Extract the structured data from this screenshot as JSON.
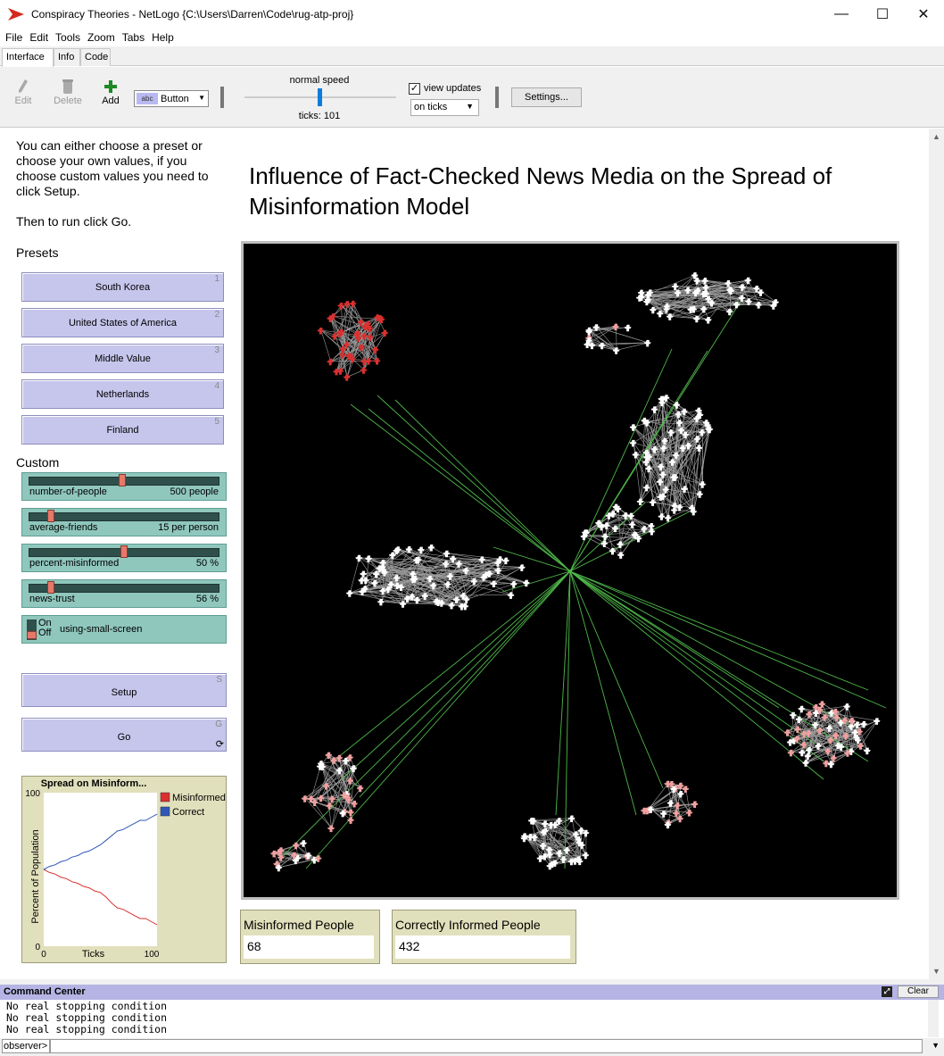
{
  "window": {
    "title": "Conspiracy Theories - NetLogo {C:\\Users\\Darren\\Code\\rug-atp-proj}",
    "controls": [
      "—",
      "☐",
      "✕"
    ]
  },
  "menu": [
    "File",
    "Edit",
    "Tools",
    "Zoom",
    "Tabs",
    "Help"
  ],
  "tabs": [
    "Interface",
    "Info",
    "Code"
  ],
  "toolbar": {
    "edit": "Edit",
    "delete": "Delete",
    "add": "Add",
    "widget_type": "Button",
    "widget_pic": "abc",
    "speed_label": "normal speed",
    "speed": 0.5,
    "ticks": "ticks: 101",
    "view_updates": "view updates",
    "update_mode": "on ticks",
    "settings": "Settings..."
  },
  "notes": {
    "intro": "You can either choose a preset or choose your own values, if you choose custom values you need to click Setup.",
    "run": "Then to run click Go.",
    "presets": "Presets",
    "custom": "Custom",
    "title": "Influence of Fact-Checked News Media on the Spread of Misinformation Model"
  },
  "presets": [
    {
      "label": "South Korea",
      "key": "1"
    },
    {
      "label": "United States of America",
      "key": "2"
    },
    {
      "label": "Middle Value",
      "key": "3"
    },
    {
      "label": "Netherlands",
      "key": "4"
    },
    {
      "label": "Finland",
      "key": "5"
    }
  ],
  "sliders": [
    {
      "name": "number-of-people",
      "value": "500 people",
      "fraction": 0.49
    },
    {
      "name": "average-friends",
      "value": "15 per person",
      "fraction": 0.1
    },
    {
      "name": "percent-misinformed",
      "value": "50 %",
      "fraction": 0.5
    },
    {
      "name": "news-trust",
      "value": "56 %",
      "fraction": 0.1
    }
  ],
  "switch": {
    "name": "using-small-screen",
    "on": "On",
    "off": "Off",
    "state": "off"
  },
  "buttons": {
    "setup": "Setup",
    "setup_key": "S",
    "go": "Go",
    "go_key": "G",
    "go_forever_icon": "forever-icon"
  },
  "plot": {
    "title": "Spread on Misinform...",
    "legend": [
      {
        "name": "Misinformed",
        "color": "#d93030"
      },
      {
        "name": "Correct",
        "color": "#2f58b8"
      }
    ],
    "ylabel": "Percent of Population",
    "xlabel": "Ticks",
    "x_ticks": [
      "0",
      "100"
    ],
    "y_ticks": [
      "0",
      "100"
    ]
  },
  "chart_data": {
    "type": "line",
    "title": "Spread on Misinform...",
    "xlabel": "Ticks",
    "ylabel": "Percent of Population",
    "xlim": [
      0,
      100
    ],
    "ylim": [
      0,
      100
    ],
    "x": [
      0,
      5,
      10,
      15,
      20,
      25,
      30,
      35,
      40,
      45,
      50,
      55,
      60,
      65,
      70,
      75,
      80,
      85,
      90,
      95,
      100
    ],
    "series": [
      {
        "name": "Misinformed",
        "color": "#d93030",
        "values": [
          50,
          48,
          47,
          45,
          44,
          42,
          41,
          39,
          38,
          36,
          35,
          32,
          28,
          25,
          24,
          22,
          20,
          18,
          18,
          16,
          14
        ]
      },
      {
        "name": "Correct",
        "color": "#2f58b8",
        "values": [
          50,
          52,
          53,
          55,
          56,
          58,
          59,
          61,
          62,
          64,
          66,
          69,
          72,
          75,
          76,
          78,
          80,
          82,
          82,
          84,
          86
        ]
      }
    ]
  },
  "monitors": [
    {
      "label": "Misinformed People",
      "value": "68"
    },
    {
      "label": "Correctly Informed People",
      "value": "432"
    }
  ],
  "view": {
    "background": "#000000",
    "misinformed_color": "#d93030",
    "pink_color": "#f0a0a0",
    "correct_color": "#ffffff",
    "news_link_color": "#4fb84a",
    "social_link_color": "#9a9a9a"
  },
  "command_center": {
    "title": "Command Center",
    "clear": "Clear",
    "output": [
      "No real stopping condition",
      "No real stopping condition",
      "No real stopping condition"
    ],
    "observer": "observer>"
  }
}
